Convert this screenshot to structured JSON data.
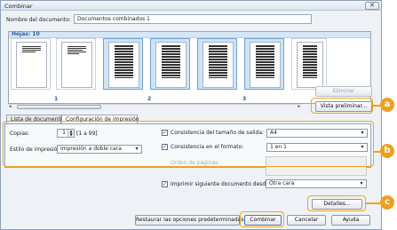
{
  "window": {
    "title": "Combinar",
    "close_glyph": "✕"
  },
  "doc_name": {
    "label": "Nombre del documento:",
    "value": "Documentos combinados 1"
  },
  "preview": {
    "header": "Hojas:  10",
    "page_numbers": [
      "1",
      "2",
      "3"
    ],
    "delete_button": "Eliminar",
    "preview_button": "Vista preliminar..."
  },
  "tabs": [
    {
      "label": "Lista de documentos"
    },
    {
      "label": "Configuración de impresión"
    }
  ],
  "settings": {
    "copies_label": "Copias:",
    "copies_value": "1",
    "copies_range": "[1 a 99]",
    "print_style_label": "Estilo de impresión:",
    "print_style_value": "Impresión a doble cara",
    "size_consistency_label": "Consistencia del tamaño de salida:",
    "size_consistency_value": "A4",
    "format_consistency_label": "Consistencia en el formato:",
    "format_consistency_value": "1 en 1",
    "page_order_label": "Orden de páginas:",
    "print_next_label": "Imprimir siguiente documento desde:",
    "print_next_value": "Otra cara"
  },
  "footer": {
    "details_button": "Detalles...",
    "restore_button": "Restaurar las opciones predeterminadas",
    "combine_button": "Combinar",
    "cancel_button": "Cancelar",
    "help_button": "Ayuda"
  },
  "callouts": {
    "a": "a",
    "b": "b",
    "c": "c"
  },
  "colors": {
    "callout": "#f0a01a",
    "tab_header": "#2a5aa0"
  }
}
